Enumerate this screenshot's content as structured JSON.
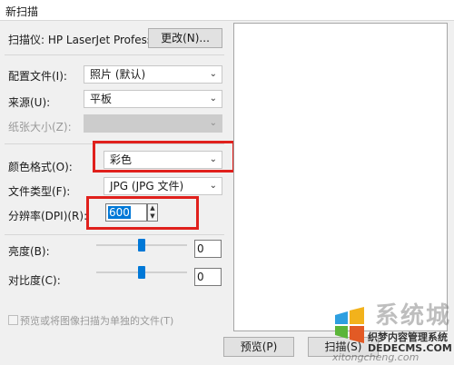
{
  "window": {
    "title": "新扫描"
  },
  "scanner": {
    "label": "扫描仪: HP LaserJet Professional M...",
    "change_button": "更改(N)..."
  },
  "form": {
    "profile_label": "配置文件(I):",
    "profile_value": "照片 (默认)",
    "source_label": "来源(U):",
    "source_value": "平板",
    "paper_size_label": "纸张大小(Z):",
    "paper_size_value": "",
    "color_format_label": "颜色格式(O):",
    "color_format_value": "彩色",
    "file_type_label": "文件类型(F):",
    "file_type_value": "JPG (JPG 文件)",
    "resolution_label": "分辨率(DPI)(R):",
    "resolution_value": "600",
    "brightness_label": "亮度(B):",
    "brightness_value": "0",
    "brightness_level": 0.5,
    "contrast_label": "对比度(C):",
    "contrast_value": "0",
    "contrast_level": 0.5,
    "separate_files_label": "预览或将图像扫描为单独的文件(T)"
  },
  "buttons": {
    "preview": "预览(P)",
    "scan": "扫描(S)"
  },
  "watermark": {
    "brand": "系统城",
    "tagline": "织梦内容管理系统",
    "url": "DEDECMS.COM",
    "site": "xitongcheng.com"
  },
  "colors": {
    "highlight": "#e0201c",
    "accent": "#0078d7"
  },
  "icons": {
    "dropdown": "chevron-down-icon",
    "spin_up": "arrow-up-icon",
    "spin_down": "arrow-down-icon",
    "logo": "windows-logo-icon"
  }
}
